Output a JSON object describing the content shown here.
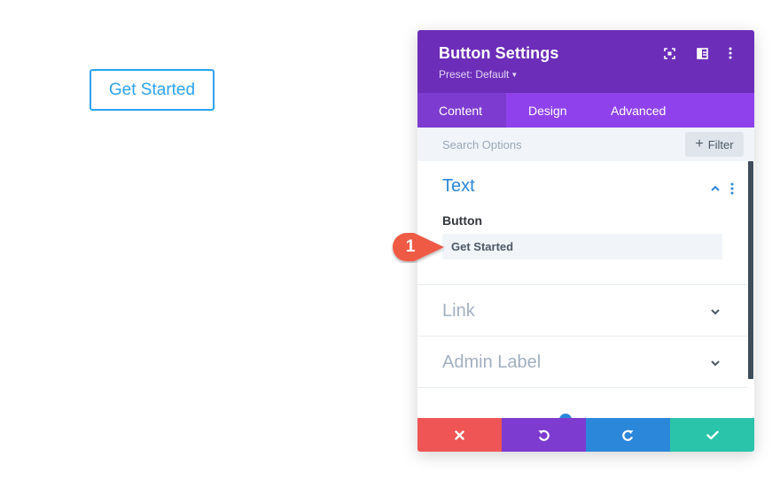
{
  "preview": {
    "button_label": "Get Started"
  },
  "panel": {
    "title": "Button Settings",
    "preset_label": "Preset: Default",
    "header_icons": [
      "expand-icon",
      "split-view-icon",
      "more-options-icon"
    ],
    "tabs": [
      {
        "label": "Content",
        "active": true
      },
      {
        "label": "Design",
        "active": false
      },
      {
        "label": "Advanced",
        "active": false
      }
    ],
    "search": {
      "placeholder": "Search Options",
      "filter_label": "Filter"
    },
    "sections": {
      "text": {
        "title": "Text",
        "expanded": true,
        "field_label": "Button",
        "field_value": "Get Started"
      },
      "link": {
        "title": "Link",
        "expanded": false
      },
      "admin_label": {
        "title": "Admin Label",
        "expanded": false
      }
    },
    "footer_buttons": [
      "close-icon",
      "undo-icon",
      "redo-icon",
      "save-check-icon"
    ]
  },
  "callout": {
    "number": "1"
  },
  "colors": {
    "header": "#6c2eb9",
    "tabs": "#8f42ec",
    "active_tab": "#7d3bcf",
    "accent_blue": "#2b87da",
    "preview_button": "#2ea3f2",
    "close": "#ef5555",
    "undo": "#7e3bd0",
    "redo": "#2b87da",
    "save": "#29c4a9",
    "callout": "#ef5a44"
  }
}
